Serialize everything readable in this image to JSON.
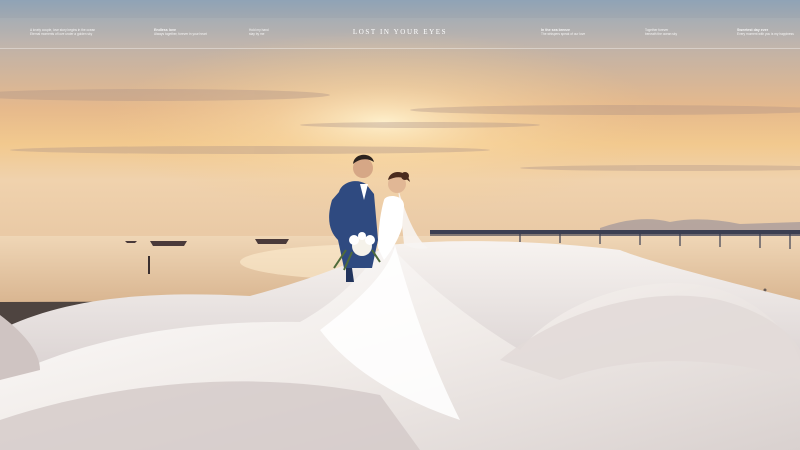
{
  "banner": {
    "title": "LOST IN YOUR EYES",
    "notes": [
      {
        "heading": "",
        "text": "A lovely couple, love story begins in the ocean\nEternal moments of love under a golden sky"
      },
      {
        "heading": "Endless love",
        "text": "Always together, forever in your heart"
      },
      {
        "heading": "",
        "text": "Hold my hand\nstay by me"
      },
      {
        "heading": "In the sea breeze",
        "text": "The whispers speak of our love"
      },
      {
        "heading": "",
        "text": "Together forever\nbeneath the ocean sky"
      },
      {
        "heading": "Sweetest day ever",
        "text": "Every moment with you is my happiness"
      }
    ]
  },
  "colors": {
    "sky_top": "#8fa3b6",
    "sky_glow": "#f2c98e",
    "sea": "#e7c7a2",
    "dress": "#f4f1ef",
    "suit": "#2f4a80"
  }
}
